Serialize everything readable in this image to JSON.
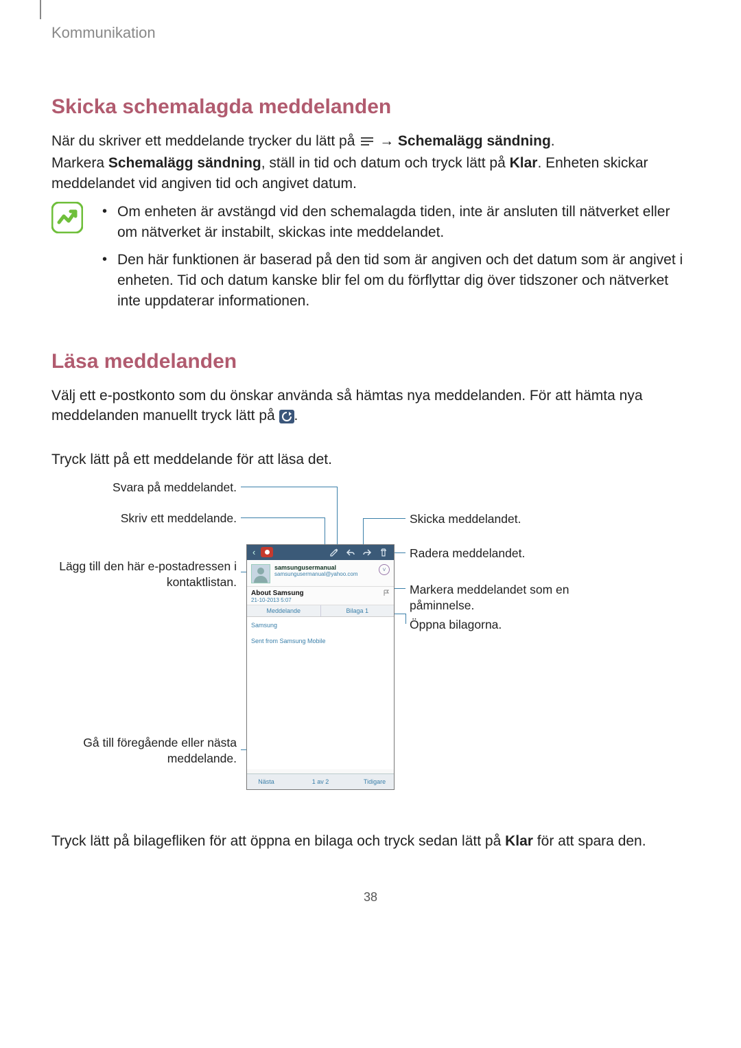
{
  "header": "Kommunikation",
  "page_number": "38",
  "section1": {
    "heading": "Skicka schemalagda meddelanden",
    "para1_a": "När du skriver ett meddelande trycker du lätt på ",
    "para1_arrow": " → ",
    "para1_bold": "Schemalägg sändning",
    "para1_end": ".",
    "para2_a": "Markera ",
    "para2_bold1": "Schemalägg sändning",
    "para2_b": ", ställ in tid och datum och tryck lätt på ",
    "para2_bold2": "Klar",
    "para2_c": ". Enheten skickar meddelandet vid angiven tid och angivet datum.",
    "note1": "Om enheten är avstängd vid den schemalagda tiden, inte är ansluten till nätverket eller om nätverket är instabilt, skickas inte meddelandet.",
    "note2": "Den här funktionen är baserad på den tid som är angiven och det datum som är angivet i enheten. Tid och datum kanske blir fel om du förflyttar dig över tidszoner och nätverket inte uppdaterar informationen."
  },
  "section2": {
    "heading": "Läsa meddelanden",
    "para1_a": "Välj ett e-postkonto som du önskar använda så hämtas nya meddelanden. För att hämta nya meddelanden manuellt tryck lätt på ",
    "para1_end": ".",
    "para2": "Tryck lätt på ett meddelande för att läsa det.",
    "bottom_a": "Tryck lätt på bilagefliken för att öppna en bilaga och tryck sedan lätt på ",
    "bottom_bold": "Klar",
    "bottom_b": " för att spara den."
  },
  "callouts": {
    "reply": "Svara på meddelandet.",
    "compose": "Skriv ett meddelande.",
    "add_contact": "Lägg till den här e-postadressen i kontaktlistan.",
    "prev_next": "Gå till föregående eller nästa meddelande.",
    "forward": "Skicka meddelandet.",
    "delete": "Radera meddelandet.",
    "remind": "Markera meddelandet som en påminnelse.",
    "attach": "Öppna bilagorna."
  },
  "phone": {
    "contact_name": "samsungusermanual",
    "contact_mail": "samsungusermanual@yahoo.com",
    "subject": "About Samsung",
    "date": "21-10-2013 5:07",
    "tab1": "Meddelande",
    "tab2": "Bilaga 1",
    "body_line1": "Samsung",
    "body_line2": "Sent from Samsung Mobile",
    "nav_prev": "Nästa",
    "nav_mid": "1 av 2",
    "nav_next": "Tidigare"
  }
}
